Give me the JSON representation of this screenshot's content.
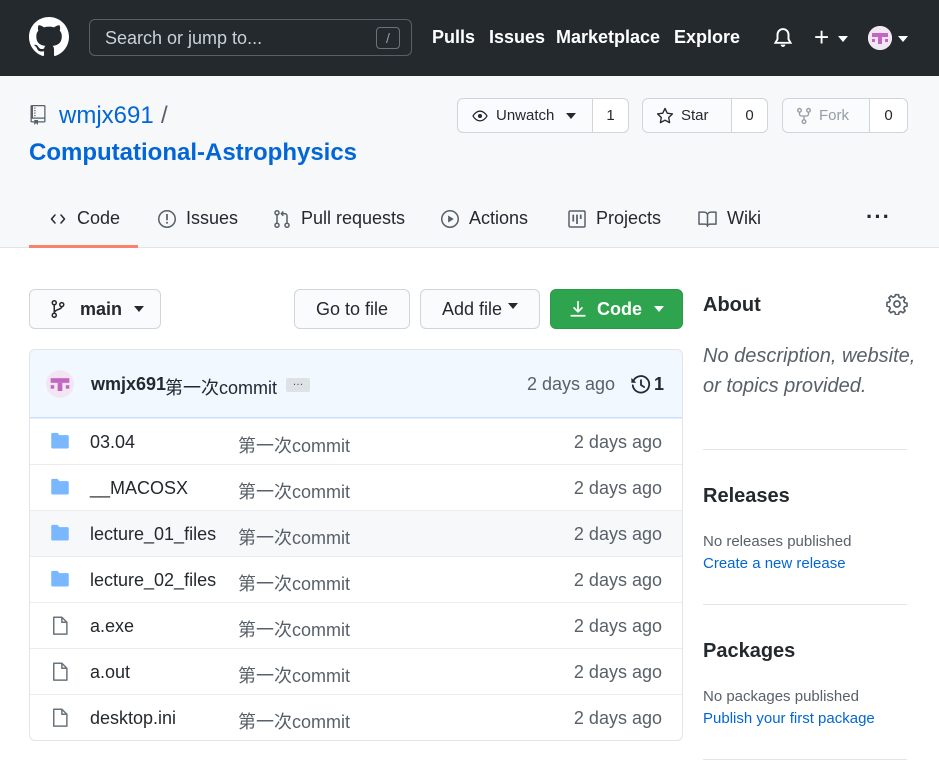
{
  "header": {
    "search_placeholder": "Search or jump to...",
    "search_shortcut": "/",
    "nav": [
      "Pulls",
      "Issues",
      "Marketplace",
      "Explore"
    ],
    "new_label": "+"
  },
  "repo": {
    "owner": "wmjx691",
    "separator": "/",
    "name": "Computational-Astrophysics",
    "watch": {
      "label": "Unwatch",
      "count": "1"
    },
    "star": {
      "label": "Star",
      "count": "0"
    },
    "fork": {
      "label": "Fork",
      "count": "0"
    }
  },
  "tabs": [
    {
      "label": "Code",
      "icon": "code-icon",
      "active": true
    },
    {
      "label": "Issues",
      "icon": "issue-icon"
    },
    {
      "label": "Pull requests",
      "icon": "pull-request-icon"
    },
    {
      "label": "Actions",
      "icon": "play-icon"
    },
    {
      "label": "Projects",
      "icon": "project-icon"
    },
    {
      "label": "Wiki",
      "icon": "book-icon"
    }
  ],
  "more_label": "···",
  "controls": {
    "branch": "main",
    "go_to_file": "Go to file",
    "add_file": "Add file",
    "code": "Code"
  },
  "latest_commit": {
    "author": "wmjx691",
    "message": "第一次commit",
    "ellipsis": "…",
    "time": "2 days ago",
    "count": "1"
  },
  "files": [
    {
      "name": "03.04",
      "type": "dir",
      "message": "第一次commit",
      "time": "2 days ago"
    },
    {
      "name": "__MACOSX",
      "type": "dir",
      "message": "第一次commit",
      "time": "2 days ago"
    },
    {
      "name": "lecture_01_files",
      "type": "dir",
      "message": "第一次commit",
      "time": "2 days ago"
    },
    {
      "name": "lecture_02_files",
      "type": "dir",
      "message": "第一次commit",
      "time": "2 days ago"
    },
    {
      "name": "a.exe",
      "type": "file",
      "message": "第一次commit",
      "time": "2 days ago"
    },
    {
      "name": "a.out",
      "type": "file",
      "message": "第一次commit",
      "time": "2 days ago"
    },
    {
      "name": "desktop.ini",
      "type": "file",
      "message": "第一次commit",
      "time": "2 days ago"
    }
  ],
  "sidebar": {
    "about_title": "About",
    "about_desc": "No description, website, or topics provided.",
    "releases_title": "Releases",
    "releases_empty": "No releases published",
    "releases_link": "Create a new release",
    "packages_title": "Packages",
    "packages_empty": "No packages published",
    "packages_link": "Publish your first package"
  },
  "colors": {
    "header_bg": "#24292e",
    "link": "#0366d6",
    "primary_button": "#2ea44f",
    "folder": "#79b8ff",
    "tab_underline": "#f9826c"
  }
}
